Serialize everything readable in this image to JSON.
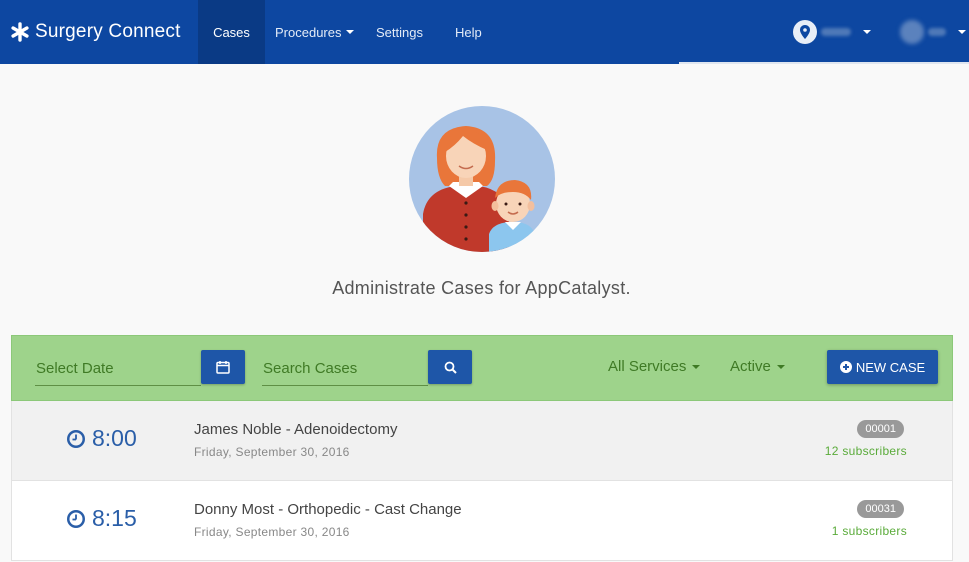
{
  "navbar": {
    "brand": "Surgery Connect",
    "items": [
      {
        "label": "Cases",
        "active": true
      },
      {
        "label": "Procedures",
        "dropdown": true
      },
      {
        "label": "Settings"
      },
      {
        "label": "Help"
      }
    ],
    "location_icon": "map-marker-icon",
    "user_icon": "user-avatar-icon"
  },
  "hero": {
    "title": "Administrate Cases for AppCatalyst."
  },
  "toolbar": {
    "date_placeholder": "Select Date",
    "search_placeholder": "Search Cases",
    "services_label": "All Services",
    "status_label": "Active",
    "new_case_label": "NEW CASE"
  },
  "cases": [
    {
      "time": "8:00",
      "title": "James Noble - Adenoidectomy",
      "date": "Friday, September 30, 2016",
      "id": "00001",
      "subscribers": "12 subscribers"
    },
    {
      "time": "8:15",
      "title": "Donny Most - Orthopedic - Cast Change",
      "date": "Friday, September 30, 2016",
      "id": "00031",
      "subscribers": "1 subscribers"
    }
  ],
  "colors": {
    "navbar": "#0d47a1",
    "toolbar": "#9ed38b",
    "primary_button": "#1e56a8",
    "time_text": "#2a5ea8",
    "subscribers_text": "#5aab3a"
  }
}
